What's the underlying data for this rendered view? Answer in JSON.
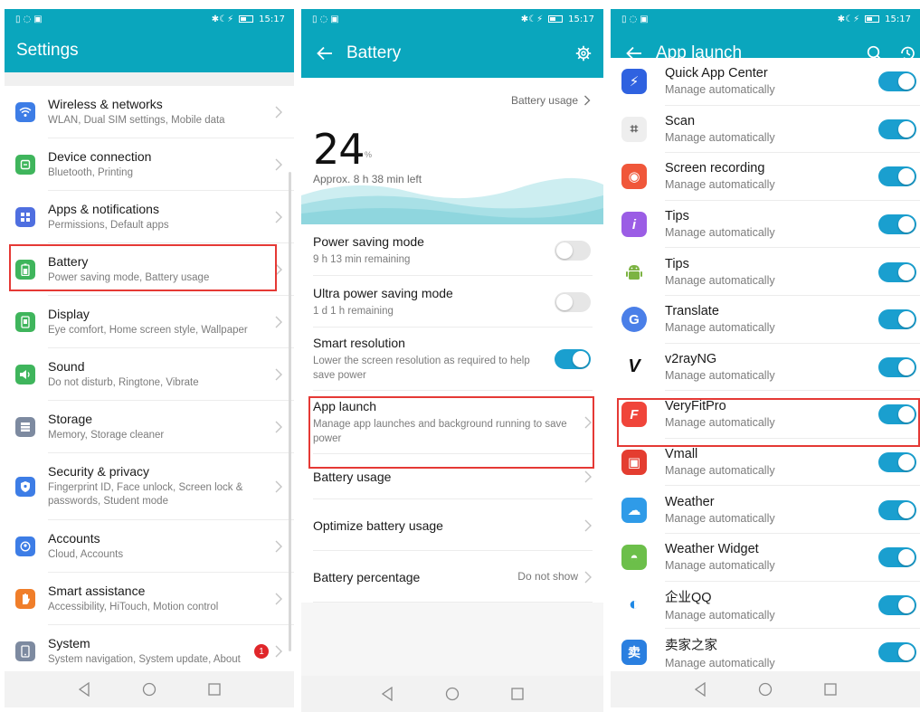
{
  "status": {
    "left_icons": "▯◌▣",
    "time": "15:17",
    "right_icons": "✱☾⚡"
  },
  "colors": {
    "accent": "#0aa6bd",
    "toggle_on": "#1a9fcf",
    "highlight": "#e53935"
  },
  "settings": {
    "title": "Settings",
    "items": [
      {
        "title": "Wireless & networks",
        "subtitle": "WLAN, Dual SIM settings, Mobile data",
        "icon": "wifi-icon"
      },
      {
        "title": "Device connection",
        "subtitle": "Bluetooth, Printing",
        "icon": "device-connection-icon"
      },
      {
        "title": "Apps & notifications",
        "subtitle": "Permissions, Default apps",
        "icon": "apps-icon"
      },
      {
        "title": "Battery",
        "subtitle": "Power saving mode, Battery usage",
        "icon": "battery-icon"
      },
      {
        "title": "Display",
        "subtitle": "Eye comfort, Home screen style, Wallpaper",
        "icon": "display-icon"
      },
      {
        "title": "Sound",
        "subtitle": "Do not disturb, Ringtone, Vibrate",
        "icon": "sound-icon"
      },
      {
        "title": "Storage",
        "subtitle": "Memory, Storage cleaner",
        "icon": "storage-icon"
      },
      {
        "title": "Security & privacy",
        "subtitle": "Fingerprint ID, Face unlock, Screen lock & passwords, Student mode",
        "icon": "shield-icon"
      },
      {
        "title": "Accounts",
        "subtitle": "Cloud, Accounts",
        "icon": "accounts-icon"
      },
      {
        "title": "Smart assistance",
        "subtitle": "Accessibility, HiTouch, Motion control",
        "icon": "hand-icon"
      },
      {
        "title": "System",
        "subtitle": "System navigation, System update, About",
        "icon": "system-icon",
        "badge": "1"
      }
    ]
  },
  "battery": {
    "title": "Battery",
    "usage_link": "Battery usage",
    "percent": "24",
    "percent_unit": "%",
    "time_left": "Approx. 8 h 38 min left",
    "items": [
      {
        "title": "Power saving mode",
        "subtitle": "9 h 13 min remaining",
        "toggle": false
      },
      {
        "title": "Ultra power saving mode",
        "subtitle": "1 d 1 h remaining",
        "toggle": false
      },
      {
        "title": "Smart resolution",
        "subtitle": "Lower the screen resolution as required to help save power",
        "toggle": true
      },
      {
        "title": "App launch",
        "subtitle": "Manage app launches and background running to save power"
      },
      {
        "title": "Battery usage"
      },
      {
        "title": "Optimize battery usage"
      },
      {
        "title": "Battery percentage",
        "value": "Do not show"
      }
    ]
  },
  "app_launch": {
    "title": "App launch",
    "apps": [
      {
        "name": "Quick App Center",
        "status": "Manage automatically",
        "icon": "quick-app-icon",
        "color": "#2f62e0",
        "glyph": "⚡",
        "on": true
      },
      {
        "name": "Scan",
        "status": "Manage automatically",
        "icon": "scan-icon",
        "color": "#eeeeee",
        "glyph": "⌗",
        "on": true
      },
      {
        "name": "Screen recording",
        "status": "Manage automatically",
        "icon": "screen-recording-icon",
        "color": "#f0573a",
        "glyph": "◉",
        "on": true
      },
      {
        "name": "Tips",
        "status": "Manage automatically",
        "icon": "tips-icon",
        "color": "#9b5de5",
        "glyph": "i",
        "on": true
      },
      {
        "name": "Tips",
        "status": "Manage automatically",
        "icon": "android-tips-icon",
        "color": "#ffffff",
        "glyph": "🤖",
        "on": true
      },
      {
        "name": "Translate",
        "status": "Manage automatically",
        "icon": "translate-icon",
        "color": "#4a7fe8",
        "glyph": "G",
        "on": true
      },
      {
        "name": "v2rayNG",
        "status": "Manage automatically",
        "icon": "v2rayng-icon",
        "color": "#ffffff",
        "glyph": "V",
        "on": true
      },
      {
        "name": "VeryFitPro",
        "status": "Manage automatically",
        "icon": "veryfitpro-icon",
        "color": "#f0453a",
        "glyph": "F",
        "on": true
      },
      {
        "name": "Vmall",
        "status": "Manage automatically",
        "icon": "vmall-icon",
        "color": "#e43d30",
        "glyph": "▣",
        "on": true
      },
      {
        "name": "Weather",
        "status": "Manage automatically",
        "icon": "weather-icon",
        "color": "#2f9be8",
        "glyph": "☁",
        "on": true
      },
      {
        "name": "Weather Widget",
        "status": "Manage automatically",
        "icon": "weather-widget-icon",
        "color": "#6cbf4a",
        "glyph": "◓",
        "on": true
      },
      {
        "name": "企业QQ",
        "status": "Manage automatically",
        "icon": "qq-icon",
        "color": "#ffffff",
        "glyph": "◐",
        "on": true
      },
      {
        "name": "卖家之家",
        "status": "Manage automatically",
        "icon": "seller-home-icon",
        "color": "#2a7fe0",
        "glyph": "卖",
        "on": true
      }
    ]
  }
}
